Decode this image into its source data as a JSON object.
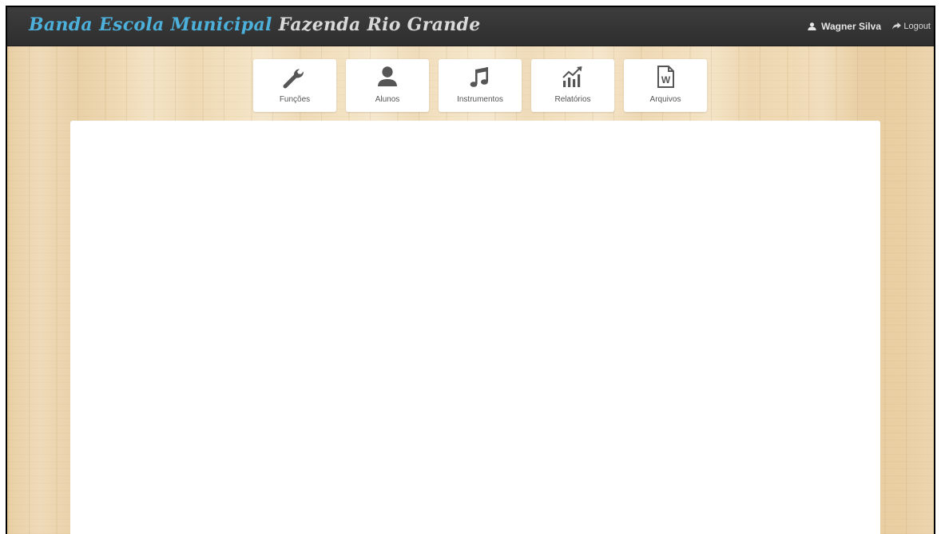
{
  "header": {
    "brand_part1": "Banda Escola Municipal",
    "brand_part2": "Fazenda Rio Grande",
    "user_name": "Wagner Silva",
    "logout_label": "Logout"
  },
  "menu": {
    "items": [
      {
        "label": "Funções",
        "icon": "wrench-icon"
      },
      {
        "label": "Alunos",
        "icon": "user-icon"
      },
      {
        "label": "Instrumentos",
        "icon": "music-note-icon"
      },
      {
        "label": "Relatórios",
        "icon": "bar-chart-icon"
      },
      {
        "label": "Arquivos",
        "icon": "word-file-icon"
      }
    ]
  },
  "colors": {
    "navbar": "#353535",
    "brand_accent": "#4cb0da",
    "brand_secondary": "#d9d9d9",
    "icon": "#555555"
  }
}
